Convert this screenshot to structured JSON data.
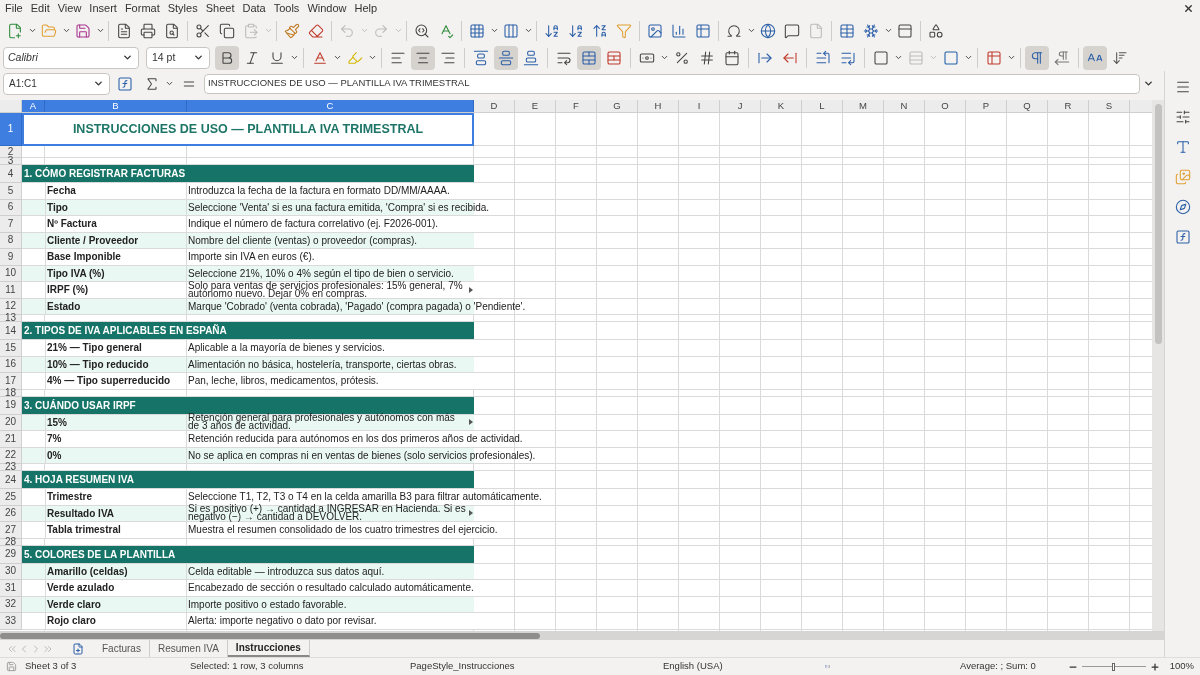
{
  "menu": [
    "File",
    "Edit",
    "View",
    "Insert",
    "Format",
    "Styles",
    "Sheet",
    "Data",
    "Tools",
    "Window",
    "Help"
  ],
  "formatting": {
    "font_name": "Calibri",
    "font_size": "14 pt",
    "bold": true,
    "italic": false,
    "underline": false,
    "align_left": false,
    "align_center": true,
    "align_right": false,
    "align_top": false,
    "align_middle": true,
    "align_bottom": false,
    "wrap_text": false,
    "merge_and_center": true,
    "paragraph_ltr": true,
    "paragraph_rtl": false,
    "text_horizontal": true,
    "text_vertical": false
  },
  "formula_bar": {
    "name_box": "A1:C1",
    "content": "INSTRUCCIONES DE USO — PLANTILLA IVA TRIMESTRAL"
  },
  "columns": [
    {
      "label": "A",
      "selected": true
    },
    {
      "label": "B",
      "selected": true
    },
    {
      "label": "C",
      "selected": true
    },
    {
      "label": "D",
      "selected": false
    },
    {
      "label": "E",
      "selected": false
    },
    {
      "label": "F",
      "selected": false
    },
    {
      "label": "G",
      "selected": false
    },
    {
      "label": "H",
      "selected": false
    },
    {
      "label": "I",
      "selected": false
    },
    {
      "label": "J",
      "selected": false
    },
    {
      "label": "K",
      "selected": false
    },
    {
      "label": "L",
      "selected": false
    },
    {
      "label": "M",
      "selected": false
    },
    {
      "label": "N",
      "selected": false
    },
    {
      "label": "O",
      "selected": false
    },
    {
      "label": "P",
      "selected": false
    },
    {
      "label": "Q",
      "selected": false
    },
    {
      "label": "R",
      "selected": false
    },
    {
      "label": "S",
      "selected": false
    }
  ],
  "rows": [
    {
      "number": "1",
      "kind": "title",
      "selected": true,
      "text": "INSTRUCCIONES DE USO — PLANTILLA IVA TRIMESTRAL"
    },
    {
      "number": "2",
      "kind": "gap",
      "selected": false
    },
    {
      "number": "3",
      "kind": "spacer",
      "selected": false
    },
    {
      "number": "4",
      "kind": "section",
      "selected": false,
      "text": "1. CÓMO REGISTRAR FACTURAS"
    },
    {
      "number": "5",
      "kind": "item",
      "selected": false,
      "shaded": false,
      "overflow": false,
      "label": "Fecha",
      "description": "Introduzca la fecha de la factura en formato DD/MM/AAAA."
    },
    {
      "number": "6",
      "kind": "item",
      "selected": false,
      "shaded": true,
      "overflow": false,
      "label": "Tipo",
      "description": "Seleccione 'Venta' si es una factura emitida, 'Compra' si es recibida."
    },
    {
      "number": "7",
      "kind": "item",
      "selected": false,
      "shaded": false,
      "overflow": false,
      "label": "Nº Factura",
      "description": "Indique el número de factura correlativo (ej. F2026-001)."
    },
    {
      "number": "8",
      "kind": "item",
      "selected": false,
      "shaded": true,
      "overflow": false,
      "label": "Cliente / Proveedor",
      "description": "Nombre del cliente (ventas) o proveedor (compras)."
    },
    {
      "number": "9",
      "kind": "item",
      "selected": false,
      "shaded": false,
      "overflow": false,
      "label": "Base Imponible",
      "description": "Importe sin IVA en euros (€)."
    },
    {
      "number": "10",
      "kind": "item",
      "selected": false,
      "shaded": true,
      "overflow": false,
      "label": "Tipo IVA (%)",
      "description": "Seleccione 21%, 10% o 4% según el tipo de bien o servicio."
    },
    {
      "number": "11",
      "kind": "item",
      "selected": false,
      "shaded": false,
      "overflow": true,
      "label": "IRPF (%)",
      "description": "Solo para ventas de servicios profesionales: 15% general, 7% autónomo nuevo. Dejar 0% en compras."
    },
    {
      "number": "12",
      "kind": "item",
      "selected": false,
      "shaded": true,
      "overflow": false,
      "label": "Estado",
      "description": "Marque 'Cobrado' (venta cobrada), 'Pagado' (compra pagada) o 'Pendiente'."
    },
    {
      "number": "13",
      "kind": "spacer",
      "selected": false
    },
    {
      "number": "14",
      "kind": "section",
      "selected": false,
      "text": "2. TIPOS DE IVA APLICABLES EN ESPAÑA"
    },
    {
      "number": "15",
      "kind": "item",
      "selected": false,
      "shaded": false,
      "overflow": false,
      "label": "21% — Tipo general",
      "description": "Aplicable a la mayoría de bienes y servicios."
    },
    {
      "number": "16",
      "kind": "item",
      "selected": false,
      "shaded": true,
      "overflow": false,
      "label": "10% — Tipo reducido",
      "description": "Alimentación no básica, hostelería, transporte, ciertas obras."
    },
    {
      "number": "17",
      "kind": "item",
      "selected": false,
      "shaded": false,
      "overflow": false,
      "label": "4% — Tipo superreducido",
      "description": "Pan, leche, libros, medicamentos, prótesis."
    },
    {
      "number": "18",
      "kind": "spacer",
      "selected": false
    },
    {
      "number": "19",
      "kind": "section",
      "selected": false,
      "text": "3. CUÁNDO USAR IRPF"
    },
    {
      "number": "20",
      "kind": "item",
      "selected": false,
      "shaded": true,
      "overflow": true,
      "label": "15%",
      "description": "Retención general para profesionales y autónomos con más de 3 años de actividad."
    },
    {
      "number": "21",
      "kind": "item",
      "selected": false,
      "shaded": false,
      "overflow": false,
      "label": "7%",
      "description": "Retención reducida para autónomos en los dos primeros años de actividad."
    },
    {
      "number": "22",
      "kind": "item",
      "selected": false,
      "shaded": true,
      "overflow": false,
      "label": "0%",
      "description": "No se aplica en compras ni en ventas de bienes (solo servicios profesionales)."
    },
    {
      "number": "23",
      "kind": "spacer",
      "selected": false
    },
    {
      "number": "24",
      "kind": "section",
      "selected": false,
      "text": "4. HOJA RESUMEN IVA"
    },
    {
      "number": "25",
      "kind": "item",
      "selected": false,
      "shaded": false,
      "overflow": false,
      "label": "Trimestre",
      "description": "Seleccione T1, T2, T3 o T4 en la celda amarilla B3 para filtrar automáticamente."
    },
    {
      "number": "26",
      "kind": "item",
      "selected": false,
      "shaded": true,
      "overflow": true,
      "label": "Resultado IVA",
      "description": "Si es positivo (+) → cantidad a INGRESAR en Hacienda. Si es negativo (−) → cantidad a DEVOLVER."
    },
    {
      "number": "27",
      "kind": "item",
      "selected": false,
      "shaded": false,
      "overflow": false,
      "label": "Tabla trimestral",
      "description": "Muestra el resumen consolidado de los cuatro trimestres del ejercicio."
    },
    {
      "number": "28",
      "kind": "spacer",
      "selected": false
    },
    {
      "number": "29",
      "kind": "section",
      "selected": false,
      "text": "5. COLORES DE LA PLANTILLA"
    },
    {
      "number": "30",
      "kind": "item",
      "selected": false,
      "shaded": true,
      "overflow": false,
      "label": "Amarillo (celdas)",
      "description": "Celda editable — introduzca sus datos aquí."
    },
    {
      "number": "31",
      "kind": "item",
      "selected": false,
      "shaded": false,
      "overflow": false,
      "label": "Verde azulado",
      "description": "Encabezado de sección o resultado calculado automáticamente."
    },
    {
      "number": "32",
      "kind": "item",
      "selected": false,
      "shaded": true,
      "overflow": false,
      "label": "Verde claro",
      "description": "Importe positivo o estado favorable."
    },
    {
      "number": "33",
      "kind": "item",
      "selected": false,
      "shaded": false,
      "overflow": false,
      "label": "Rojo claro",
      "description": "Alerta: importe negativo o dato por revisar."
    }
  ],
  "sheet_tabs": [
    {
      "label": "Facturas",
      "selected": false
    },
    {
      "label": "Resumen IVA",
      "selected": false
    },
    {
      "label": "Instrucciones",
      "selected": true
    }
  ],
  "status_bar": {
    "sheet": "Sheet 3 of 3",
    "selection": "Selected: 1 row, 3 columns",
    "page_style": "PageStyle_Instrucciones",
    "language": "English (USA)",
    "summary": "Average: ; Sum: 0",
    "zoom": "100%",
    "zoom_slider": {
      "level": 0.5
    }
  }
}
